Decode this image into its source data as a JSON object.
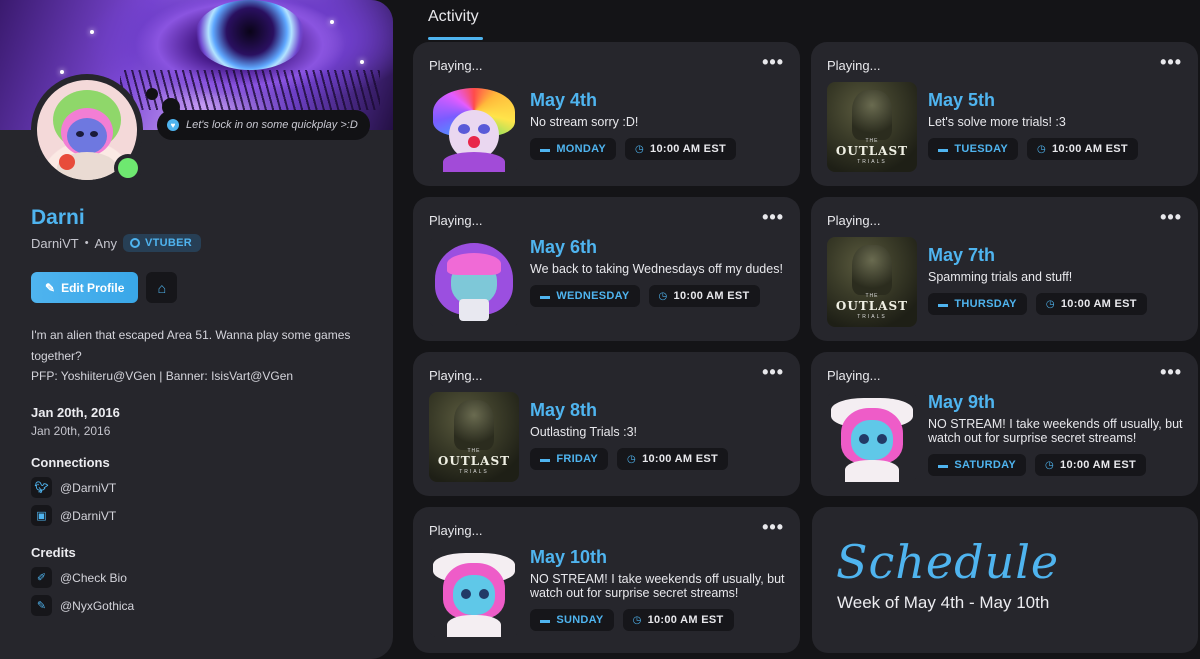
{
  "profile": {
    "status_text": "Let's lock in on some quickplay >:D",
    "display_name": "Darni",
    "username": "DarniVT",
    "pronouns": "Any",
    "badge": "VTUBER",
    "edit_label": "Edit Profile",
    "bio_line1": "I'm an alien that escaped Area 51. Wanna play some games together?",
    "bio_line2": "PFP: Yoshiiteru@VGen | Banner: IsisVart@VGen",
    "date_title": "Jan 20th, 2016",
    "date_sub": "Jan 20th, 2016",
    "connections_title": "Connections",
    "connections": [
      {
        "icon": "twitter-icon",
        "label": "@DarniVT"
      },
      {
        "icon": "twitch-icon",
        "label": "@DarniVT"
      }
    ],
    "credits_title": "Credits",
    "credits": [
      {
        "icon": "brush-icon",
        "label": "@Check Bio"
      },
      {
        "icon": "pen-icon",
        "label": "@NyxGothica"
      }
    ]
  },
  "activity": {
    "tab_label": "Activity",
    "playing_label": "Playing...",
    "more_label": "•••",
    "cards": [
      {
        "date": "May 4th",
        "desc": "No stream sorry :D!",
        "day": "MONDAY",
        "time": "10:00 AM EST",
        "thumb": "clown"
      },
      {
        "date": "May 5th",
        "desc": "Let's solve more trials! :3",
        "day": "TUESDAY",
        "time": "10:00 AM EST",
        "thumb": "outlast"
      },
      {
        "date": "May 6th",
        "desc": "We back to taking Wednesdays off my dudes!",
        "day": "WEDNESDAY",
        "time": "10:00 AM EST",
        "thumb": "hoodie"
      },
      {
        "date": "May 7th",
        "desc": "Spamming trials and stuff!",
        "day": "THURSDAY",
        "time": "10:00 AM EST",
        "thumb": "outlast"
      },
      {
        "date": "May 8th",
        "desc": "Outlasting Trials :3!",
        "day": "FRIDAY",
        "time": "10:00 AM EST",
        "thumb": "outlast"
      },
      {
        "date": "May 9th",
        "desc": "NO STREAM! I take weekends off usually, but watch out for surprise secret streams!",
        "day": "SATURDAY",
        "time": "10:00 AM EST",
        "thumb": "bunny"
      },
      {
        "date": "May 10th",
        "desc": "NO STREAM! I take weekends off usually, but watch out for surprise secret streams!",
        "day": "SUNDAY",
        "time": "10:00 AM EST",
        "thumb": "bunny"
      }
    ],
    "outlast_the": "THE",
    "outlast_title": "OUTLAST",
    "outlast_trials": "TRIALS"
  },
  "schedule": {
    "title": "Schedule",
    "subtitle": "Week of May 4th - May 10th"
  },
  "colors": {
    "accent": "#4fb4ef",
    "card_bg": "#26262c",
    "page_bg": "#141417",
    "online": "#6ee870"
  }
}
